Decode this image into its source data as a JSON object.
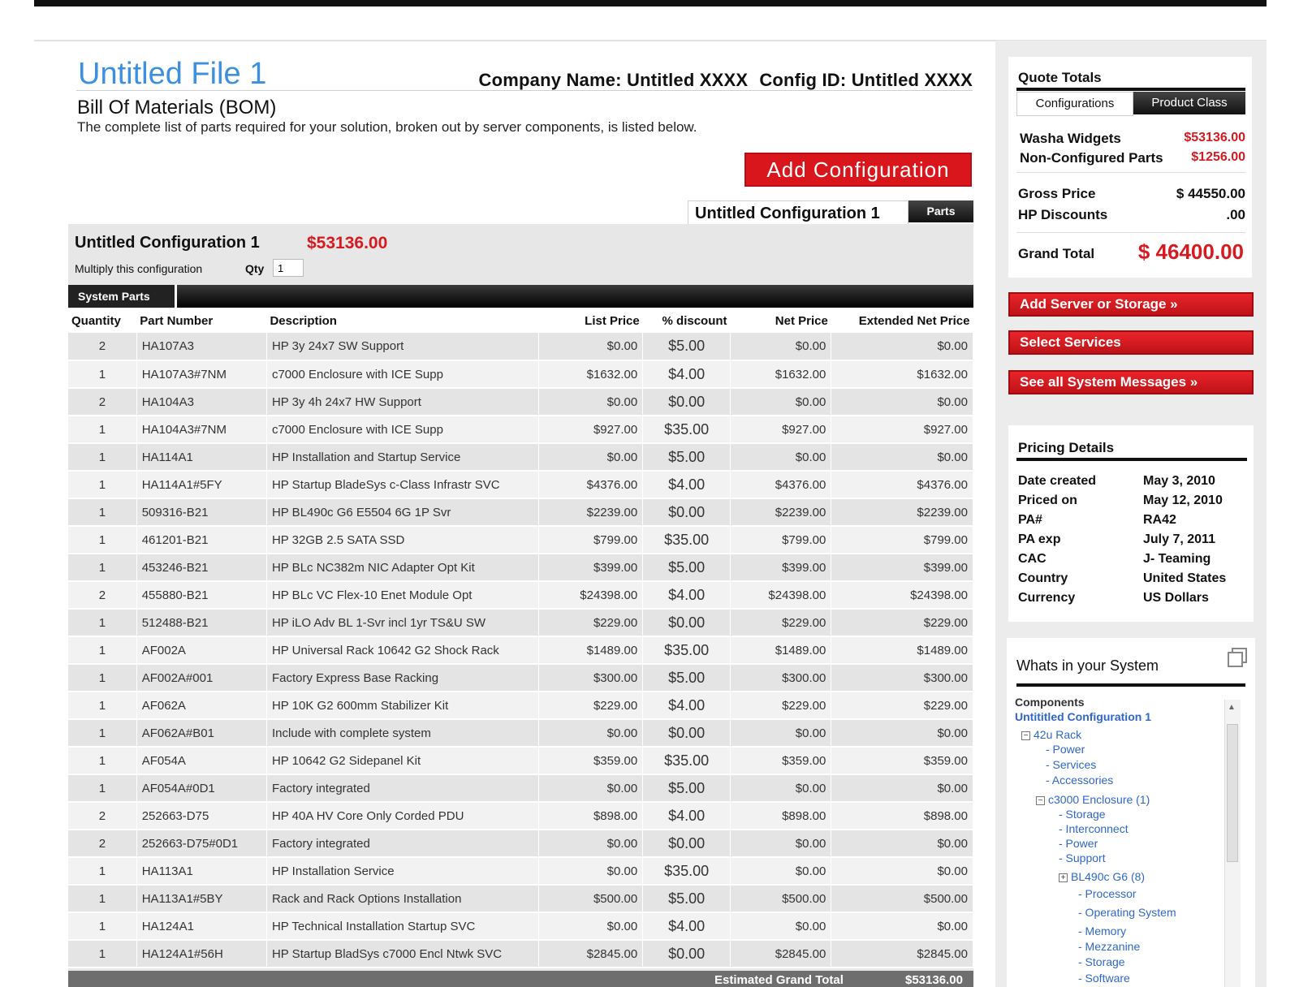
{
  "header": {
    "file_title": "Untitled File 1",
    "company_label": "Company Name: Untitled XXXX",
    "config_id_label": "Config ID: Untitled XXXX",
    "bom_title": "Bill Of Materials (BOM)",
    "bom_description": "The complete list of parts required for your solution, broken out by server components, is listed below.",
    "add_configuration_label": "Add Configuration"
  },
  "config_tabs": {
    "config_tab_label": "Untitled Configuration 1",
    "parts_tab_label": "Parts"
  },
  "configuration": {
    "name": "Untitled Configuration 1",
    "price": "$53136.00",
    "multiply_label": "Multiply this configuration",
    "qty_label": "Qty",
    "qty_value": "1",
    "section_tab": "System Parts"
  },
  "table": {
    "columns": [
      "Quantity",
      "Part Number",
      "Description",
      "List Price",
      "% discount",
      "Net Price",
      "Extended Net Price"
    ],
    "rows": [
      [
        "2",
        "HA107A3",
        "HP 3y 24x7 SW Support",
        "$0.00",
        "$5.00",
        "$0.00",
        "$0.00"
      ],
      [
        "1",
        "HA107A3#7NM",
        "c7000 Enclosure with ICE Supp",
        "$1632.00",
        "$4.00",
        "$1632.00",
        "$1632.00"
      ],
      [
        "2",
        "HA104A3",
        "HP 3y 4h 24x7 HW Support",
        "$0.00",
        "$0.00",
        "$0.00",
        "$0.00"
      ],
      [
        "1",
        "HA104A3#7NM",
        "c7000 Enclosure with ICE Supp",
        "$927.00",
        "$35.00",
        "$927.00",
        "$927.00"
      ],
      [
        "1",
        "HA114A1",
        "HP Installation and Startup Service",
        "$0.00",
        "$5.00",
        "$0.00",
        "$0.00"
      ],
      [
        "1",
        "HA114A1#5FY",
        "HP Startup BladeSys c-Class Infrastr SVC",
        "$4376.00",
        "$4.00",
        "$4376.00",
        "$4376.00"
      ],
      [
        "1",
        "509316-B21",
        "HP BL490c G6 E5504 6G 1P Svr",
        "$2239.00",
        "$0.00",
        "$2239.00",
        "$2239.00"
      ],
      [
        "1",
        "461201-B21",
        "HP 32GB 2.5 SATA SSD",
        "$799.00",
        "$35.00",
        "$799.00",
        "$799.00"
      ],
      [
        "1",
        "453246-B21",
        "HP BLc NC382m NIC Adapter Opt Kit",
        "$399.00",
        "$5.00",
        "$399.00",
        "$399.00"
      ],
      [
        "2",
        "455880-B21",
        "HP BLc VC Flex-10 Enet Module Opt",
        "$24398.00",
        "$4.00",
        "$24398.00",
        "$24398.00"
      ],
      [
        "1",
        "512488-B21",
        "HP iLO Adv BL 1-Svr incl 1yr TS&U SW",
        "$229.00",
        "$0.00",
        "$229.00",
        "$229.00"
      ],
      [
        "1",
        "AF002A",
        "HP Universal Rack 10642 G2 Shock Rack",
        "$1489.00",
        "$35.00",
        "$1489.00",
        "$1489.00"
      ],
      [
        "1",
        "AF002A#001",
        "Factory Express Base Racking",
        "$300.00",
        "$5.00",
        "$300.00",
        "$300.00"
      ],
      [
        "1",
        "AF062A",
        "HP 10K G2 600mm Stabilizer Kit",
        "$229.00",
        "$4.00",
        "$229.00",
        "$229.00"
      ],
      [
        "1",
        "AF062A#B01",
        "Include with complete system",
        "$0.00",
        "$0.00",
        "$0.00",
        "$0.00"
      ],
      [
        "1",
        "AF054A",
        "HP 10642 G2 Sidepanel Kit",
        "$359.00",
        "$35.00",
        "$359.00",
        "$359.00"
      ],
      [
        "1",
        "AF054A#0D1",
        "Factory integrated",
        "$0.00",
        "$5.00",
        "$0.00",
        "$0.00"
      ],
      [
        "2",
        "252663-D75",
        "HP 40A HV Core Only Corded PDU",
        "$898.00",
        "$4.00",
        "$898.00",
        "$898.00"
      ],
      [
        "2",
        "252663-D75#0D1",
        "Factory integrated",
        "$0.00",
        "$0.00",
        "$0.00",
        "$0.00"
      ],
      [
        "1",
        "HA113A1",
        "HP Installation Service",
        "$0.00",
        "$35.00",
        "$0.00",
        "$0.00"
      ],
      [
        "1",
        "HA113A1#5BY",
        "Rack and Rack Options Installation",
        "$500.00",
        "$5.00",
        "$500.00",
        "$500.00"
      ],
      [
        "1",
        "HA124A1",
        "HP Technical Installation Startup SVC",
        "$0.00",
        "$4.00",
        "$0.00",
        "$0.00"
      ],
      [
        "1",
        "HA124A1#56H",
        "HP Startup BladSys c7000 Encl Ntwk SVC",
        "$2845.00",
        "$0.00",
        "$2845.00",
        "$2845.00"
      ]
    ],
    "grand_total_label": "Estimated Grand Total",
    "grand_total_value": "$53136.00"
  },
  "quote_totals": {
    "title": "Quote Totals",
    "tab_configurations": "Configurations",
    "tab_product_class": "Product Class",
    "lines": [
      {
        "label": "Washa Widgets",
        "value": "$53136.00"
      },
      {
        "label": "Non-Configured Parts",
        "value": "$1256.00"
      }
    ],
    "gross_label": "Gross Price",
    "gross_value": "$ 44550.00",
    "discount_label": "HP Discounts",
    "discount_value": ".00",
    "grand_label": "Grand Total",
    "grand_value": "$ 46400.00"
  },
  "actions": {
    "add_server": "Add Server or Storage »",
    "select_services": "Select Services",
    "see_messages": "See all System Messages »"
  },
  "pricing_details": {
    "title": "Pricing Details",
    "rows": [
      {
        "label": "Date created",
        "value": "May 3, 2010"
      },
      {
        "label": "Priced on",
        "value": "May 12, 2010"
      },
      {
        "label": "PA#",
        "value": "RA42"
      },
      {
        "label": "PA exp",
        "value": "July 7, 2011"
      },
      {
        "label": "CAC",
        "value": "J- Teaming"
      },
      {
        "label": "Country",
        "value": "United States"
      },
      {
        "label": "Currency",
        "value": "US Dollars"
      }
    ]
  },
  "whats_in_system": {
    "title": "Whats in your System",
    "components_label": "Components",
    "config_link": "Untititled Configuration 1",
    "rack": "42u Rack",
    "rack_children": [
      "- Power",
      "- Services",
      "- Accessories"
    ],
    "enclosure": "c3000 Enclosure (1)",
    "enclosure_children": [
      "- Storage",
      "- Interconnect",
      "- Power",
      "- Support"
    ],
    "server": "BL490c G6 (8)",
    "server_children": [
      "- Processor",
      "- Operating System",
      "- Memory",
      "- Mezzanine",
      "- Storage",
      "- Software"
    ],
    "toggle_minus": "⊟",
    "toggle_plus": "⊞"
  }
}
